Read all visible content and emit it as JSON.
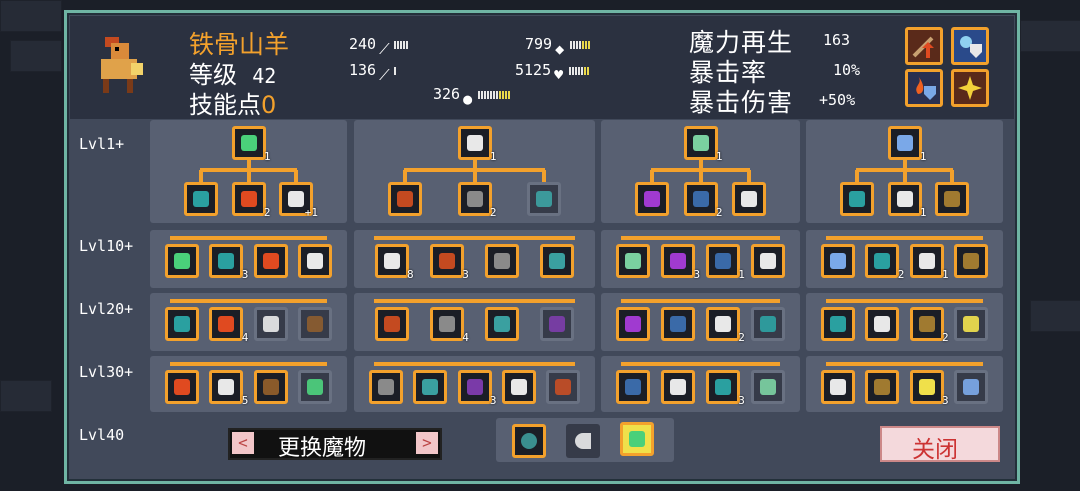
{
  "monster": {
    "name": "铁骨山羊",
    "level_label": "等级",
    "level": "42",
    "skill_points_label": "技能点",
    "skill_points": "0"
  },
  "stats": {
    "attack": "240",
    "magic_attack": "136",
    "armor": "799",
    "health": "5125",
    "speed": "326"
  },
  "secondary": {
    "mana_regen_label": "魔力再生",
    "mana_regen": "163",
    "crit_rate_label": "暴击率",
    "crit_rate": "10%",
    "crit_damage_label": "暴击伤害",
    "crit_damage": "+50%"
  },
  "levels": [
    "Lvl1+",
    "Lvl10+",
    "Lvl20+",
    "Lvl30+",
    "Lvl40"
  ],
  "nodes": {
    "t1_top": "1",
    "t1_l1_mid": "2",
    "t1_l1_right": "+1",
    "t1_l10": "3",
    "t1_l20": "4",
    "t1_l30": "5",
    "t2_top": "1",
    "t2_l1": "2",
    "t2_l10a": "8",
    "t2_l10b": "3",
    "t2_l20": "4",
    "t2_l30": "3",
    "t3_top": "1",
    "t3_l1": "2",
    "t3_l10a": "3",
    "t3_l10b": "1",
    "t3_l20": "2",
    "t3_l30": "3",
    "t4_top": "1",
    "t4_l1": "1",
    "t4_l10a": "2",
    "t4_l10b": "1",
    "t4_l20": "2",
    "t4_l30": "3"
  },
  "footer": {
    "change_monster_label": "更换魔物",
    "prev_icon": "<",
    "next_icon": ">",
    "close_label": "关闭"
  },
  "colors": {
    "accent": "#f3a12c",
    "panel_border": "#6fb5a4",
    "panel_bg": "#41495a"
  }
}
